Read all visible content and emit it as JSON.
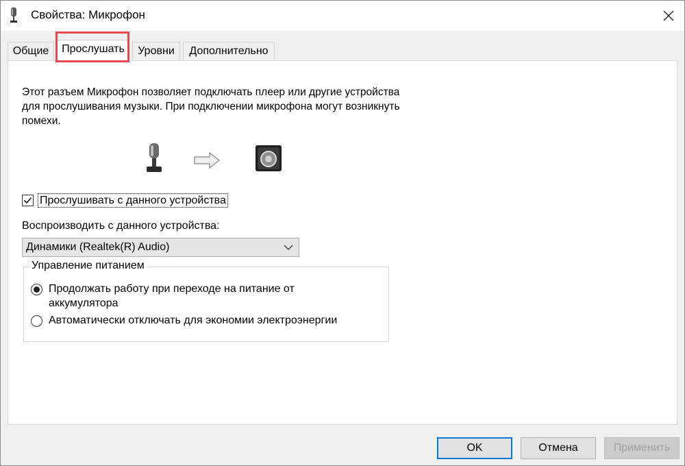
{
  "window": {
    "title": "Свойства: Микрофон",
    "icons": {
      "app": "microphone-icon",
      "close": "close-icon"
    }
  },
  "tabs": [
    {
      "label": "Общие"
    },
    {
      "label": "Прослушать",
      "active": true
    },
    {
      "label": "Уровни"
    },
    {
      "label": "Дополнительно"
    }
  ],
  "listen": {
    "description": "Этот разъем Микрофон позволяет подключать плеер или другие устройства для прослушивания музыки. При подключении микрофона могут возникнуть помехи.",
    "illustration": {
      "left": "microphone-icon",
      "middle": "arrow-right-icon",
      "right": "speaker-icon"
    },
    "listen_checkbox": {
      "label": "Прослушивать с данного устройства",
      "checked": true
    },
    "playback_label": "Воспроизводить с данного устройства:",
    "playback_device": {
      "value": "Динамики (Realtek(R) Audio)"
    },
    "power": {
      "legend": "Управление питанием",
      "options": [
        {
          "label": "Продолжать работу при переходе на питание от аккумулятора",
          "selected": true
        },
        {
          "label": "Автоматически отключать для экономии электроэнергии",
          "selected": false
        }
      ]
    }
  },
  "buttons": {
    "ok": "OK",
    "cancel": "Отмена",
    "apply": "Применить"
  },
  "colors": {
    "highlight": "#e8484f",
    "focus": "#0078d7"
  }
}
